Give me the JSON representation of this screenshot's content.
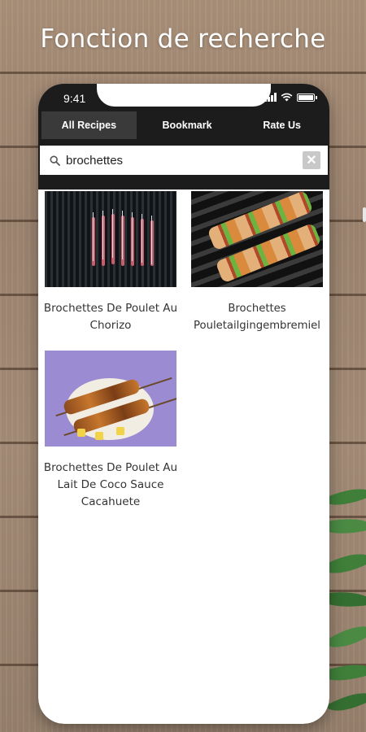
{
  "headline": "Fonction de recherche",
  "status": {
    "time": "9:41"
  },
  "tabs": [
    {
      "label": "All Recipes",
      "active": true
    },
    {
      "label": "Bookmark",
      "active": false
    },
    {
      "label": "Rate Us",
      "active": false
    }
  ],
  "search": {
    "value": "brochettes",
    "clear_glyph": "✕"
  },
  "results": [
    {
      "title": "Brochettes De Poulet Au Chorizo",
      "image": "grilled-skewers-photo"
    },
    {
      "title": "Brochettes Pouletailgingembremiel",
      "image": "chicken-pepper-skewers-photo"
    },
    {
      "title": "Brochettes De Poulet Au Lait De Coco Sauce Cacahuete",
      "image": "skewers-on-rice-photo"
    }
  ],
  "colors": {
    "tab_bar": "#1c1c1c",
    "active_tab": "#3a3a3a",
    "title_text": "#333333"
  }
}
